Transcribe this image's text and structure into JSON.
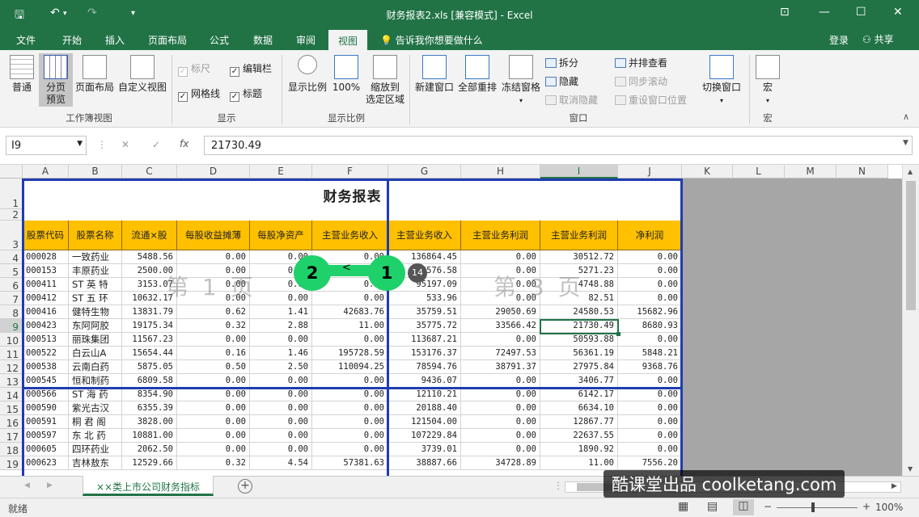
{
  "window": {
    "title": "财务报表2.xls  [兼容模式] - Excel",
    "quick_access": {
      "save": "🖫",
      "undo": "↶",
      "redo": "↷",
      "customize": "▾"
    },
    "controls": {
      "ribbon_options": "⊡",
      "minimize": "—",
      "maximize": "☐",
      "close": "✕"
    }
  },
  "tabs": [
    "文件",
    "开始",
    "插入",
    "页面布局",
    "公式",
    "数据",
    "审阅",
    "视图"
  ],
  "active_tab": "视图",
  "tell_me": "告诉我你想要做什么",
  "account": {
    "login": "登录",
    "share": "共享"
  },
  "ribbon": {
    "workbook_views": {
      "label": "工作簿视图",
      "normal": "普通",
      "page_break": "分页\n预览",
      "page_layout": "页面布局",
      "custom": "自定义视图"
    },
    "show": {
      "label": "显示",
      "ruler": "标尺",
      "formula_bar": "编辑栏",
      "gridlines": "网格线",
      "headings": "标题"
    },
    "zoom": {
      "label": "显示比例",
      "zoom": "显示比例",
      "hundred": "100%",
      "to_selection": "缩放到\n选定区域"
    },
    "window": {
      "label": "窗口",
      "new_window": "新建窗口",
      "arrange_all": "全部重排",
      "freeze": "冻结窗格",
      "split": "拆分",
      "hide": "隐藏",
      "unhide": "取消隐藏",
      "side_by_side": "并排查看",
      "sync_scroll": "同步滚动",
      "reset_pos": "重设窗口位置",
      "switch": "切换窗口"
    },
    "macros": {
      "label": "宏",
      "macros": "宏"
    }
  },
  "formula_bar": {
    "name_box": "I9",
    "cancel": "✕",
    "enter": "✓",
    "fx": "fx",
    "value": "21730.49"
  },
  "columns": [
    "A",
    "B",
    "C",
    "D",
    "E",
    "F",
    "G",
    "H",
    "I",
    "J",
    "K",
    "L",
    "M",
    "N"
  ],
  "selected_column": "I",
  "selected_row": "9",
  "sheet": {
    "title": "财务报表",
    "headers": [
      "股票代码",
      "股票名称",
      "流通×股",
      "每股收益摊薄",
      "每股净资产",
      "主营业务收入",
      "主营业务收入",
      "主营业务利润",
      "主营业务利润",
      "净利润"
    ],
    "rows": [
      [
        "4",
        "000028",
        "一致药业",
        "5488.56",
        "0.00",
        "0.00",
        "0.00",
        "136864.45",
        "0.00",
        "30512.72",
        "0.00"
      ],
      [
        "5",
        "000153",
        "丰原药业",
        "2500.00",
        "0.00",
        "0.00",
        "0.00",
        "14576.58",
        "0.00",
        "5271.23",
        "0.00"
      ],
      [
        "6",
        "000411",
        "ST 英 特",
        "3153.07",
        "0.00",
        "0.00",
        "0.00",
        "95197.09",
        "0.00",
        "4748.88",
        "0.00"
      ],
      [
        "7",
        "000412",
        "ST 五 环",
        "10632.17",
        "0.00",
        "0.00",
        "0.00",
        "533.96",
        "0.00",
        "82.51",
        "0.00"
      ],
      [
        "8",
        "000416",
        "健特生物",
        "13831.79",
        "0.62",
        "1.41",
        "42683.76",
        "35759.51",
        "29050.69",
        "24580.53",
        "15682.96"
      ],
      [
        "9",
        "000423",
        "东阿阿胶",
        "19175.34",
        "0.32",
        "2.88",
        "11.00",
        "35775.72",
        "33566.42",
        "21730.49",
        "8680.93"
      ],
      [
        "10",
        "000513",
        "丽珠集团",
        "11567.23",
        "0.00",
        "0.00",
        "0.00",
        "113687.21",
        "0.00",
        "50593.88",
        "0.00"
      ],
      [
        "11",
        "000522",
        "白云山A",
        "15654.44",
        "0.16",
        "1.46",
        "195728.59",
        "153176.37",
        "72497.53",
        "56361.19",
        "5848.21"
      ],
      [
        "12",
        "000538",
        "云南白药",
        "5875.05",
        "0.50",
        "2.50",
        "110094.25",
        "78594.76",
        "38791.37",
        "27975.84",
        "9368.76"
      ],
      [
        "13",
        "000545",
        "恒和制药",
        "6809.58",
        "0.00",
        "0.00",
        "0.00",
        "9436.07",
        "0.00",
        "3406.77",
        "0.00"
      ],
      [
        "14",
        "000566",
        "ST 海 药",
        "8354.90",
        "0.00",
        "0.00",
        "0.00",
        "12110.21",
        "0.00",
        "6142.17",
        "0.00"
      ],
      [
        "15",
        "000590",
        "紫光古汉",
        "6355.39",
        "0.00",
        "0.00",
        "0.00",
        "20188.40",
        "0.00",
        "6634.10",
        "0.00"
      ],
      [
        "16",
        "000591",
        "桐 君 阁",
        "3828.00",
        "0.00",
        "0.00",
        "0.00",
        "121504.00",
        "0.00",
        "12867.77",
        "0.00"
      ],
      [
        "17",
        "000597",
        "东 北 药",
        "10881.00",
        "0.00",
        "0.00",
        "0.00",
        "107229.84",
        "0.00",
        "22637.55",
        "0.00"
      ],
      [
        "18",
        "000605",
        "四环药业",
        "2062.50",
        "0.00",
        "0.00",
        "0.00",
        "3739.01",
        "0.00",
        "1890.92",
        "0.00"
      ],
      [
        "19",
        "000623",
        "吉林敖东",
        "12529.66",
        "0.32",
        "4.54",
        "57381.63",
        "38887.66",
        "34728.89",
        "11.00",
        "7556.20"
      ]
    ],
    "page_watermarks": [
      "第 1 页",
      "第 3 页"
    ]
  },
  "annotations": {
    "step2": "2",
    "step1": "1",
    "badge": "14",
    "drag_arrow": "<"
  },
  "sheet_tab": "××类上市公司财务指标",
  "add_sheet": "+",
  "status": {
    "ready": "就绪",
    "zoom": "100%",
    "zoom_minus": "−",
    "zoom_plus": "+"
  },
  "brand_watermark": "酷课堂出品 coolketang.com",
  "colors": {
    "excel_green": "#217346",
    "header_fill": "#ffc000",
    "page_break": "#1f3cb0",
    "annotation": "#1fd16a"
  }
}
